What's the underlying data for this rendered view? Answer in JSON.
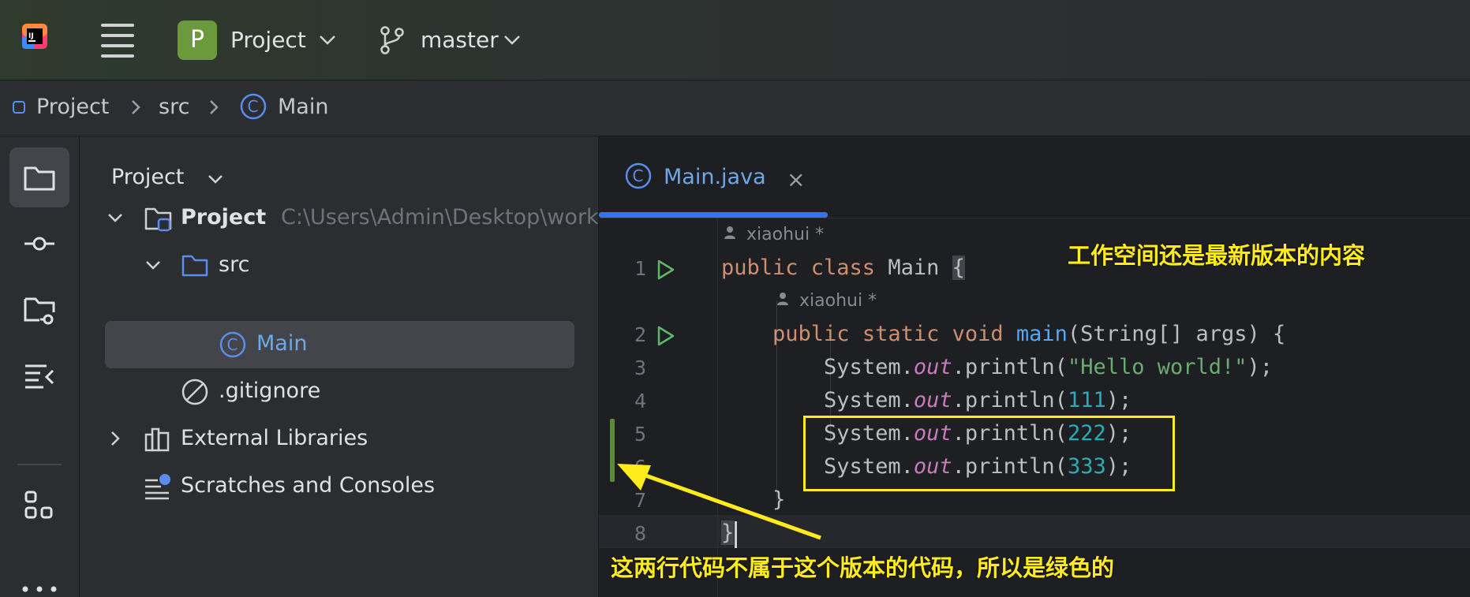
{
  "topbar": {
    "project_badge": "P",
    "project_name": "Project",
    "branch": "master"
  },
  "breadcrumb": [
    "Project",
    "src",
    "Main"
  ],
  "project_panel": {
    "title": "Project",
    "tree": [
      {
        "label": "Project",
        "path": "C:\\Users\\Admin\\Desktop\\work",
        "expanded": true
      },
      {
        "label": "src",
        "expanded": true
      },
      {
        "label": "Main",
        "selected": true
      },
      {
        "label": ".gitignore"
      },
      {
        "label": "External Libraries",
        "expanded": false
      },
      {
        "label": "Scratches and Consoles"
      }
    ]
  },
  "editor": {
    "tab_label": "Main.java",
    "tab_close": "×",
    "author_1": "xiaohui *",
    "author_2": "xiaohui *",
    "line_numbers": [
      "1",
      "2",
      "3",
      "4",
      "5",
      "6",
      "7",
      "8"
    ],
    "code": {
      "l1_kw": "public class ",
      "l1_name": "Main ",
      "l1_brace": "{",
      "l2_kw": "public static void ",
      "l2_fn": "main",
      "l2_rest": "(String[] args) {",
      "sys": "System.",
      "out": "out",
      "println": ".println(",
      "l3_str": "\"Hello world!\"",
      "l4_num": "111",
      "l5_num": "222",
      "l6_num": "333",
      "close_paren": ");",
      "l7": "}",
      "l8": "}"
    }
  },
  "annotations": {
    "top_right": "工作空间还是最新版本的内容",
    "bottom": "这两行代码不属于这个版本的代码，所以是绿色的"
  },
  "colors": {
    "annotation": "#ffec1a",
    "accent": "#3574f0",
    "vcs_added": "#5b8a3a"
  }
}
